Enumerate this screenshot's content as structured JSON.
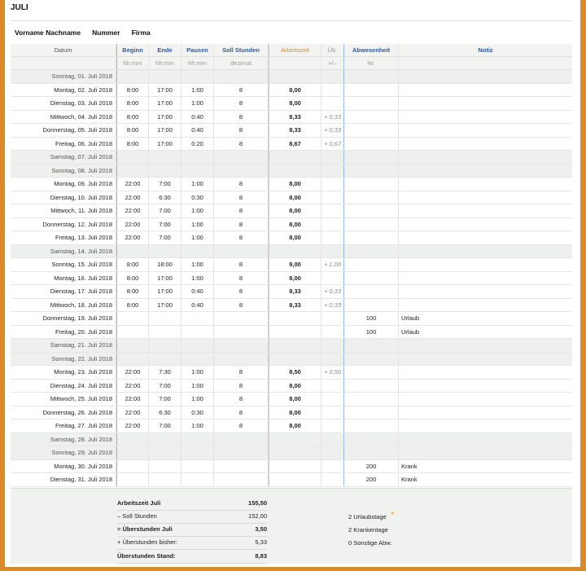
{
  "title": "JULI",
  "header_fields": {
    "name": "Vorname Nachname",
    "number": "Nummer",
    "company": "Firma"
  },
  "columns": {
    "datum": "Datum",
    "beginn": "Beginn",
    "ende": "Ende",
    "pausen": "Pausen",
    "soll": "Soll Stunden",
    "arbeitszeit": "Arbeitszeit",
    "ub": "Üb.",
    "abwesenheit": "Abwesenheit",
    "notiz": "Notiz"
  },
  "subheaders": {
    "datum": "",
    "beginn": "hh:mm",
    "ende": "hh:mm",
    "pausen": "hh:mm",
    "soll": "dezimal",
    "arbeitszeit": "",
    "ub": "+/–",
    "abwesenheit": "Nr.",
    "notiz": ""
  },
  "rows": [
    {
      "date": "Sonntag, 01. Juli 2018",
      "weekend": true,
      "beginn": "",
      "ende": "",
      "pausen": "",
      "soll": "",
      "arbeitszeit": "",
      "ub": "",
      "abw": "",
      "notiz": ""
    },
    {
      "date": "Montag, 02. Juli 2018",
      "weekend": false,
      "beginn": "8:00",
      "ende": "17:00",
      "pausen": "1:00",
      "soll": "8",
      "arbeitszeit": "8,00",
      "ub": "",
      "abw": "",
      "notiz": ""
    },
    {
      "date": "Dienstag, 03. Juli 2018",
      "weekend": false,
      "beginn": "8:00",
      "ende": "17:00",
      "pausen": "1:00",
      "soll": "8",
      "arbeitszeit": "8,00",
      "ub": "",
      "abw": "",
      "notiz": ""
    },
    {
      "date": "Mittwoch, 04. Juli 2018",
      "weekend": false,
      "beginn": "8:00",
      "ende": "17:00",
      "pausen": "0:40",
      "soll": "8",
      "arbeitszeit": "8,33",
      "ub": "+ 0,33",
      "abw": "",
      "notiz": ""
    },
    {
      "date": "Donnerstag, 05. Juli 2018",
      "weekend": false,
      "beginn": "8:00",
      "ende": "17:00",
      "pausen": "0:40",
      "soll": "8",
      "arbeitszeit": "8,33",
      "ub": "+ 0,33",
      "abw": "",
      "notiz": ""
    },
    {
      "date": "Freitag, 06. Juli 2018",
      "weekend": false,
      "beginn": "8:00",
      "ende": "17:00",
      "pausen": "0:20",
      "soll": "8",
      "arbeitszeit": "8,67",
      "ub": "+ 0,67",
      "abw": "",
      "notiz": ""
    },
    {
      "date": "Samstag, 07. Juli 2018",
      "weekend": true,
      "beginn": "",
      "ende": "",
      "pausen": "",
      "soll": "",
      "arbeitszeit": "",
      "ub": "",
      "abw": "",
      "notiz": ""
    },
    {
      "date": "Sonntag, 08. Juli 2018",
      "weekend": true,
      "beginn": "",
      "ende": "",
      "pausen": "",
      "soll": "",
      "arbeitszeit": "",
      "ub": "",
      "abw": "",
      "notiz": ""
    },
    {
      "date": "Montag, 09. Juli 2018",
      "weekend": false,
      "beginn": "22:00",
      "ende": "7:00",
      "pausen": "1:00",
      "soll": "8",
      "arbeitszeit": "8,00",
      "ub": "",
      "abw": "",
      "notiz": ""
    },
    {
      "date": "Dienstag, 10. Juli 2018",
      "weekend": false,
      "beginn": "22:00",
      "ende": "6:30",
      "pausen": "0:30",
      "soll": "8",
      "arbeitszeit": "8,00",
      "ub": "",
      "abw": "",
      "notiz": ""
    },
    {
      "date": "Mittwoch, 11. Juli 2018",
      "weekend": false,
      "beginn": "22:00",
      "ende": "7:00",
      "pausen": "1:00",
      "soll": "8",
      "arbeitszeit": "8,00",
      "ub": "",
      "abw": "",
      "notiz": ""
    },
    {
      "date": "Donnerstag, 12. Juli 2018",
      "weekend": false,
      "beginn": "22:00",
      "ende": "7:00",
      "pausen": "1:00",
      "soll": "8",
      "arbeitszeit": "8,00",
      "ub": "",
      "abw": "",
      "notiz": ""
    },
    {
      "date": "Freitag, 13. Juli 2018",
      "weekend": false,
      "beginn": "22:00",
      "ende": "7:00",
      "pausen": "1:00",
      "soll": "8",
      "arbeitszeit": "8,00",
      "ub": "",
      "abw": "",
      "notiz": ""
    },
    {
      "date": "Samstag, 14. Juli 2018",
      "weekend": true,
      "beginn": "",
      "ende": "",
      "pausen": "",
      "soll": "",
      "arbeitszeit": "",
      "ub": "",
      "abw": "",
      "notiz": ""
    },
    {
      "date": "Sonntag, 15. Juli 2018",
      "weekend": false,
      "beginn": "8:00",
      "ende": "18:00",
      "pausen": "1:00",
      "soll": "8",
      "arbeitszeit": "9,00",
      "ub": "+ 1,00",
      "abw": "",
      "notiz": ""
    },
    {
      "date": "Montag, 16. Juli 2018",
      "weekend": false,
      "beginn": "8:00",
      "ende": "17:00",
      "pausen": "1:00",
      "soll": "8",
      "arbeitszeit": "8,00",
      "ub": "",
      "abw": "",
      "notiz": ""
    },
    {
      "date": "Dienstag, 17. Juli 2018",
      "weekend": false,
      "beginn": "8:00",
      "ende": "17:00",
      "pausen": "0:40",
      "soll": "8",
      "arbeitszeit": "8,33",
      "ub": "+ 0,33",
      "abw": "",
      "notiz": ""
    },
    {
      "date": "Mittwoch, 18. Juli 2018",
      "weekend": false,
      "beginn": "8:00",
      "ende": "17:00",
      "pausen": "0:40",
      "soll": "8",
      "arbeitszeit": "8,33",
      "ub": "+ 0,33",
      "abw": "",
      "notiz": ""
    },
    {
      "date": "Donnerstag, 19. Juli 2018",
      "weekend": false,
      "beginn": "",
      "ende": "",
      "pausen": "",
      "soll": "",
      "arbeitszeit": "",
      "ub": "",
      "abw": "100",
      "notiz": "Urlaub"
    },
    {
      "date": "Freitag, 20. Juli 2018",
      "weekend": false,
      "beginn": "",
      "ende": "",
      "pausen": "",
      "soll": "",
      "arbeitszeit": "",
      "ub": "",
      "abw": "100",
      "notiz": "Urlaub"
    },
    {
      "date": "Samstag, 21. Juli 2018",
      "weekend": true,
      "beginn": "",
      "ende": "",
      "pausen": "",
      "soll": "",
      "arbeitszeit": "",
      "ub": "",
      "abw": "",
      "notiz": ""
    },
    {
      "date": "Sonntag, 22. Juli 2018",
      "weekend": true,
      "beginn": "",
      "ende": "",
      "pausen": "",
      "soll": "",
      "arbeitszeit": "",
      "ub": "",
      "abw": "",
      "notiz": ""
    },
    {
      "date": "Montag, 23. Juli 2018",
      "weekend": false,
      "beginn": "22:00",
      "ende": "7:30",
      "pausen": "1:00",
      "soll": "8",
      "arbeitszeit": "8,50",
      "ub": "+ 0,50",
      "abw": "",
      "notiz": ""
    },
    {
      "date": "Dienstag, 24. Juli 2018",
      "weekend": false,
      "beginn": "22:00",
      "ende": "7:00",
      "pausen": "1:00",
      "soll": "8",
      "arbeitszeit": "8,00",
      "ub": "",
      "abw": "",
      "notiz": ""
    },
    {
      "date": "Mittwoch, 25. Juli 2018",
      "weekend": false,
      "beginn": "22:00",
      "ende": "7:00",
      "pausen": "1:00",
      "soll": "8",
      "arbeitszeit": "8,00",
      "ub": "",
      "abw": "",
      "notiz": ""
    },
    {
      "date": "Donnerstag, 26. Juli 2018",
      "weekend": false,
      "beginn": "22:00",
      "ende": "6:30",
      "pausen": "0:30",
      "soll": "8",
      "arbeitszeit": "8,00",
      "ub": "",
      "abw": "",
      "notiz": ""
    },
    {
      "date": "Freitag, 27. Juli 2018",
      "weekend": false,
      "beginn": "22:00",
      "ende": "7:00",
      "pausen": "1:00",
      "soll": "8",
      "arbeitszeit": "8,00",
      "ub": "",
      "abw": "",
      "notiz": ""
    },
    {
      "date": "Samstag, 28. Juli 2018",
      "weekend": true,
      "beginn": "",
      "ende": "",
      "pausen": "",
      "soll": "",
      "arbeitszeit": "",
      "ub": "",
      "abw": "",
      "notiz": ""
    },
    {
      "date": "Sonntag, 29. Juli 2018",
      "weekend": true,
      "beginn": "",
      "ende": "",
      "pausen": "",
      "soll": "",
      "arbeitszeit": "",
      "ub": "",
      "abw": "",
      "notiz": ""
    },
    {
      "date": "Montag, 30. Juli 2018",
      "weekend": false,
      "beginn": "",
      "ende": "",
      "pausen": "",
      "soll": "",
      "arbeitszeit": "",
      "ub": "",
      "abw": "200",
      "notiz": "Krank"
    },
    {
      "date": "Dienstag, 31. Juli 2018",
      "weekend": false,
      "beginn": "",
      "ende": "",
      "pausen": "",
      "soll": "",
      "arbeitszeit": "",
      "ub": "",
      "abw": "200",
      "notiz": "Krank"
    }
  ],
  "summary": {
    "lines": [
      {
        "label": "Arbeitszeit Juli",
        "value": "155,50",
        "bold": true
      },
      {
        "label": "– Soll Stunden",
        "value": "152,00",
        "bold": false
      },
      {
        "label": "= Überstunden Juli",
        "value": "3,50",
        "bold": true
      },
      {
        "label": "+ Überstunden bisher:",
        "value": "5,33",
        "bold": false
      },
      {
        "label": "Überstunden Stand:",
        "value": "8,83",
        "bold": true
      }
    ],
    "absences": [
      "2 Urlaubstage",
      "2 Krankentage",
      "0 Sonstige Abw."
    ]
  },
  "colors": {
    "accent_blue": "#2c5aa0",
    "accent_orange": "#e08a2a",
    "frame": "#d98a2a",
    "weekend_bg": "#eef0ed"
  }
}
